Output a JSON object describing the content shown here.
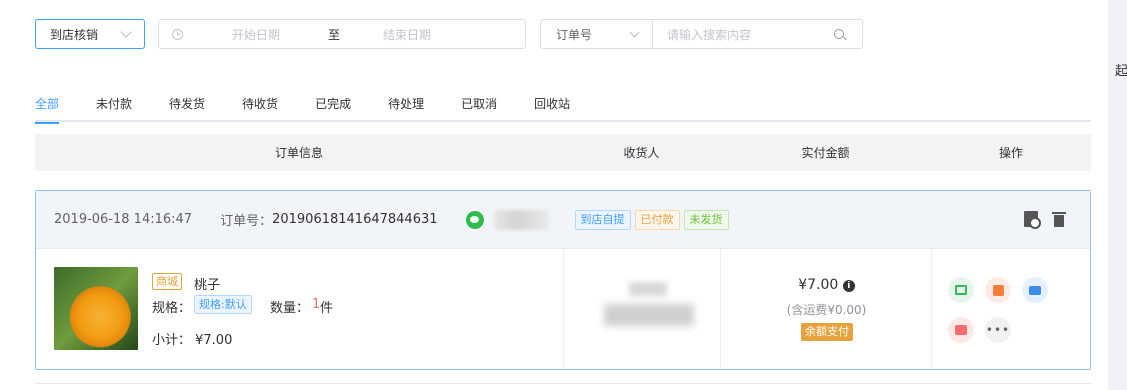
{
  "filters": {
    "mode_select": "到店核销",
    "date_start_placeholder": "开始日期",
    "date_separator": "至",
    "date_end_placeholder": "结束日期",
    "search_field_select": "订单号",
    "search_placeholder": "请输入搜索内容"
  },
  "tabs": [
    {
      "label": "全部",
      "active": true
    },
    {
      "label": "未付款"
    },
    {
      "label": "待发货"
    },
    {
      "label": "待收货"
    },
    {
      "label": "已完成"
    },
    {
      "label": "待处理"
    },
    {
      "label": "已取消"
    },
    {
      "label": "回收站"
    }
  ],
  "table_headers": {
    "order_info": "订单信息",
    "receiver": "收货人",
    "paid_amount": "实付金额",
    "actions": "操作"
  },
  "order": {
    "date": "2019-06-18 14:16:47",
    "order_no_label": "订单号：",
    "order_no": "20190618141647844631",
    "tags": [
      "到店自提",
      "已付款",
      "未发货"
    ],
    "goods": {
      "source_tag": "商城",
      "name": "桃子",
      "spec_label": "规格：",
      "spec_value": "规格:默认",
      "qty_label": "数量：",
      "qty_value": "1",
      "qty_unit": "件",
      "subtotal": "小计：  ¥7.00"
    },
    "amount": "¥7.00",
    "shipping_note": "(含运费¥0.00)",
    "payment_method": "余额支付"
  },
  "edge_char": "起",
  "colors": {
    "accent": "#409eff",
    "warning": "#e6a23c",
    "success": "#67c23a",
    "danger": "#f56c6c"
  }
}
